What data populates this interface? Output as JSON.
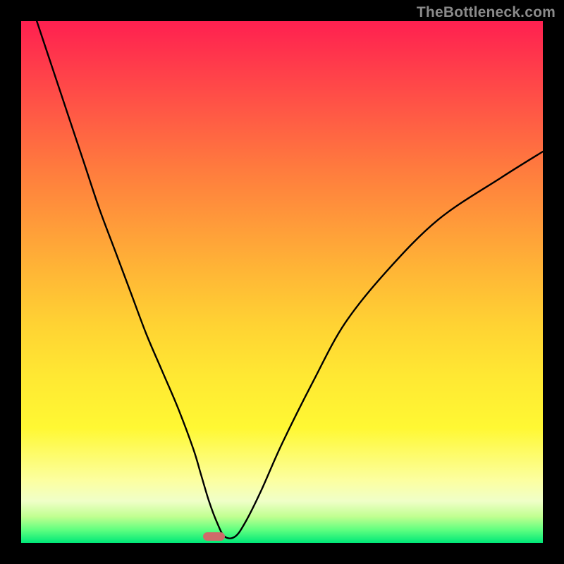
{
  "watermark": "TheBottleneck.com",
  "chart_data": {
    "type": "line",
    "title": "",
    "xlabel": "",
    "ylabel": "",
    "xlim": [
      0,
      100
    ],
    "ylim": [
      0,
      100
    ],
    "grid": false,
    "legend": null,
    "series": [
      {
        "name": "bottleneck-curve",
        "x": [
          3,
          6,
          9,
          12,
          15,
          18,
          21,
          24,
          27,
          30,
          33,
          34.5,
          36,
          37.5,
          39,
          41,
          43,
          46,
          50,
          56,
          62,
          70,
          80,
          92,
          100
        ],
        "values": [
          100,
          91,
          82,
          73,
          64,
          56,
          48,
          40,
          33,
          26,
          18,
          13,
          8,
          4,
          1.2,
          1.2,
          4,
          10,
          19,
          31,
          42,
          52,
          62,
          70,
          75
        ]
      }
    ],
    "marker": {
      "x": 37,
      "y": 1.2,
      "width_pct": 4.2,
      "height_pct": 1.6,
      "color": "#cf6a6a"
    },
    "background_gradient": {
      "stops": [
        {
          "pos": 0,
          "color": "#ff2050"
        },
        {
          "pos": 50,
          "color": "#ffc834"
        },
        {
          "pos": 80,
          "color": "#fffb70"
        },
        {
          "pos": 100,
          "color": "#00e878"
        }
      ]
    }
  }
}
